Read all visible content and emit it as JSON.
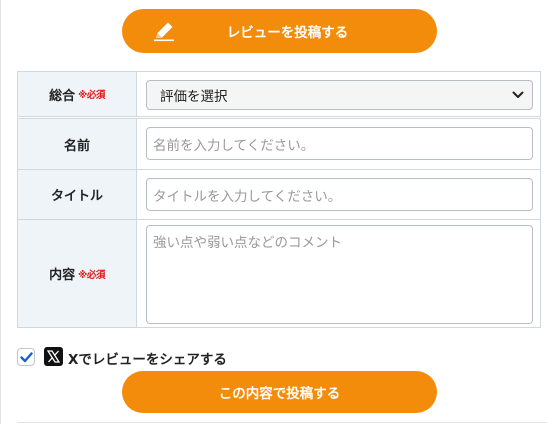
{
  "header": {
    "review_button_label": "レビューを投稿する"
  },
  "form": {
    "rating": {
      "label": "総合",
      "required": "※必須",
      "selected": "評価を選択"
    },
    "name": {
      "label": "名前",
      "placeholder": "名前を入力してください。"
    },
    "title": {
      "label": "タイトル",
      "placeholder": "タイトルを入力してください。"
    },
    "content": {
      "label": "内容",
      "required": "※必須",
      "placeholder": "強い点や弱い点などのコメント"
    }
  },
  "share": {
    "checked": true,
    "label": "Xでレビューをシェアする"
  },
  "submit": {
    "label": "この内容で投稿する"
  },
  "colors": {
    "accent": "#f38b0b",
    "header_cell": "#eef4f8",
    "required": "#e0191a"
  },
  "icons": [
    "pencil-icon",
    "chevron-down-icon",
    "checkmark-icon",
    "x-logo-icon"
  ]
}
